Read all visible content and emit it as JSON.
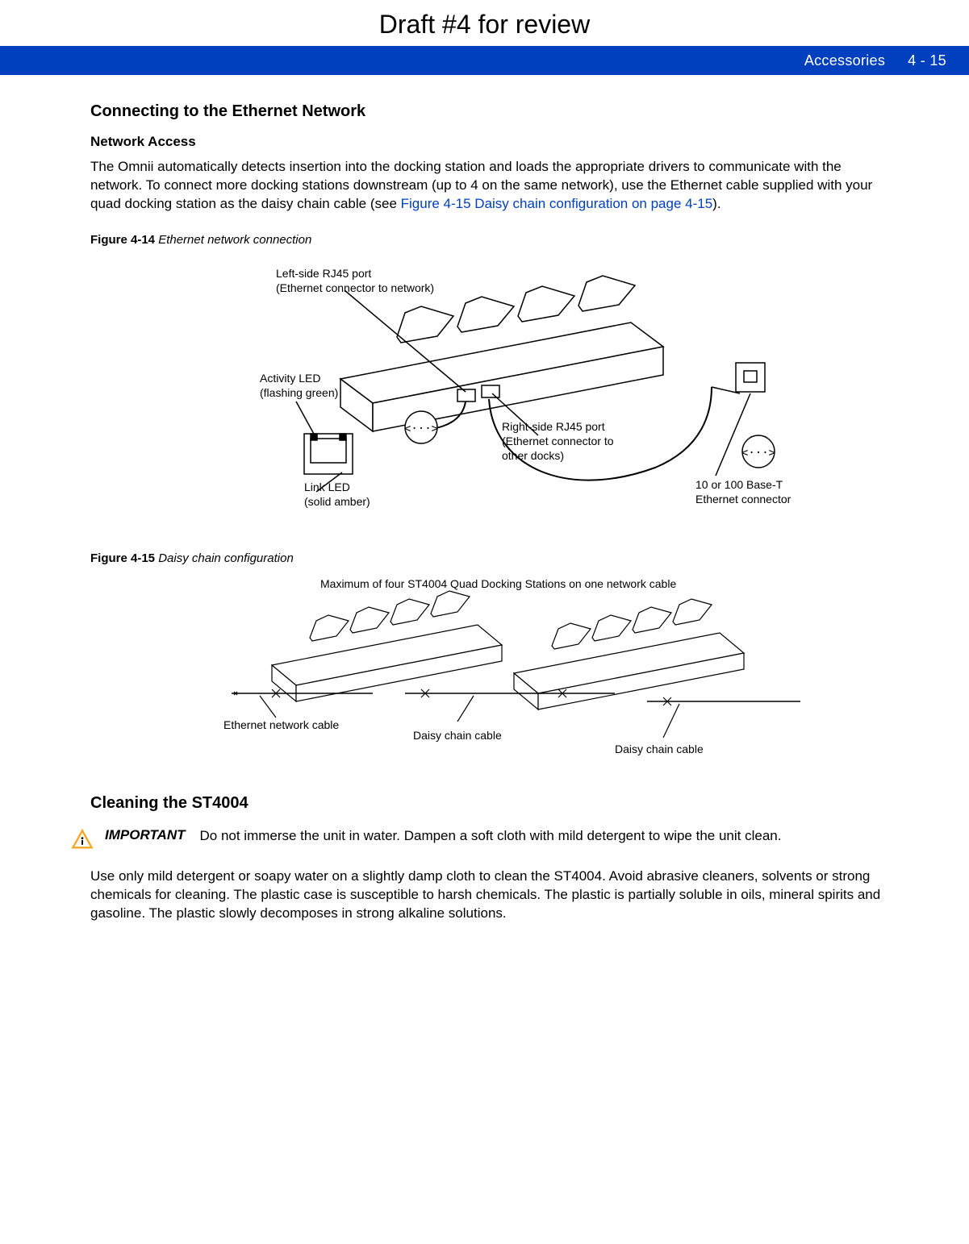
{
  "draft_header": "Draft #4 for review",
  "header": {
    "section": "Accessories",
    "page_ref": "4 - 15"
  },
  "section1": {
    "title": "Connecting to the Ethernet Network",
    "subtitle": "Network Access",
    "para_pre": "The Omnii automatically detects insertion into the docking station and loads the appropriate drivers to communicate with the network. To connect more docking stations downstream (up to 4 on the same network), use the Ethernet cable supplied with your quad docking station as the daisy chain cable (see ",
    "para_link": "Figure 4-15 Daisy chain configuration  on page 4-15",
    "para_post": ")."
  },
  "figure414": {
    "label": "Figure 4-14",
    "title": "Ethernet network connection",
    "callouts": {
      "left_port_l1": "Left-side RJ45 port",
      "left_port_l2": "(Ethernet connector to network)",
      "activity_l1": "Activity LED",
      "activity_l2": "(flashing green)",
      "link_l1": "Link LED",
      "link_l2": "(solid amber)",
      "right_port_l1": "Right-side RJ45 port",
      "right_port_l2": "(Ethernet connector to",
      "right_port_l3": " other docks)",
      "ethernet_l1": "10 or 100 Base-T",
      "ethernet_l2": "Ethernet connector"
    }
  },
  "figure415": {
    "label": "Figure 4-15",
    "title": "Daisy chain configuration",
    "callouts": {
      "top": "Maximum of four ST4004 Quad Docking Stations on one network cable",
      "ethernet_cable": "Ethernet network cable",
      "daisy1": "Daisy chain cable",
      "daisy2": "Daisy chain cable"
    }
  },
  "section2": {
    "title": "Cleaning the ST4004",
    "important_label": "IMPORTANT",
    "important_text": "Do not immerse the unit in water. Dampen a soft cloth with mild detergent to wipe the unit clean.",
    "para": "Use only mild detergent or soapy water on a slightly damp cloth to clean the ST4004. Avoid abrasive cleaners, solvents or strong chemicals for cleaning. The plastic case is susceptible to harsh chemicals. The plastic is partially soluble in oils, mineral spirits and gasoline. The plastic slowly decomposes in strong alkaline solutions."
  }
}
